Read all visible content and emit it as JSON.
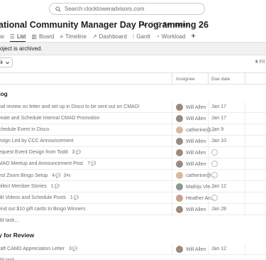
{
  "search": {
    "placeholder": "Search clocktoweradvisors.com"
  },
  "project": {
    "title": "ational Community Manager Day Programming 26",
    "set_status": "Set status"
  },
  "tabs": [
    {
      "label": "w",
      "icon": "overview-icon"
    },
    {
      "label": "List",
      "icon": "list-icon"
    },
    {
      "label": "Board",
      "icon": "board-icon"
    },
    {
      "label": "Timeline",
      "icon": "timeline-icon"
    },
    {
      "label": "Dashboard",
      "icon": "dashboard-icon"
    },
    {
      "label": "Gantt",
      "icon": "gantt-icon"
    },
    {
      "label": "Workload",
      "icon": "workload-icon"
    }
  ],
  "banner": {
    "text": "oject is archived."
  },
  "toolbar": {
    "add_label": "k",
    "filter_label": "Fil"
  },
  "columns": {
    "assignee": "Assignee",
    "due_date": "Due date"
  },
  "sections": [
    {
      "title": "log",
      "tasks": [
        {
          "name": "nal review on letter and set up in Disco to be sent out on CMAD!",
          "count": "",
          "assignee": "Will Allen",
          "due": "Jan 17",
          "avatar_color": "#9a8a80"
        },
        {
          "name": "reate and Schedule Internal CMAD Promotion",
          "count": "",
          "assignee": "Will Allen",
          "due": "Jan 17",
          "avatar_color": "#9a8a80"
        },
        {
          "name": "chedule Event in Disco",
          "count": "",
          "assignee": "catherine@...",
          "due": "Jan 9",
          "avatar_color": "#d8b8a0"
        },
        {
          "name": "esign Led by CCC Announcement",
          "count": "",
          "assignee": "Will Allen",
          "due": "Jan 10",
          "avatar_color": "#9a8a80"
        },
        {
          "name": "equest Event Design from Todd",
          "count": "3",
          "assignee": "Will Allen",
          "due": "",
          "avatar_color": "#9a8a80"
        },
        {
          "name": "MAD Meetup and Announcement Post",
          "count": "7",
          "assignee": "Will Allen",
          "due": "",
          "avatar_color": "#9a8a80"
        },
        {
          "name": "est Zoom Bingo Setup",
          "count": "4",
          "count2": "3",
          "assignee": "catherine@...",
          "due": "",
          "avatar_color": "#d8b8a0"
        },
        {
          "name": "ollect Member Stories",
          "count": "1",
          "assignee": "Mathijs Vle...",
          "due": "Jan 12",
          "avatar_color": "#8a9a8a"
        },
        {
          "name": "dit Videos and Schedule Posts",
          "count": "1",
          "assignee": "Heather An...",
          "due": "",
          "avatar_color": "#c8a090"
        },
        {
          "name": "end out $10 gift cards to Bingo Winners",
          "count": "",
          "assignee": "Will Allen",
          "due": "Jan 28",
          "avatar_color": "#9a8a80"
        }
      ],
      "add_task": "dd task..."
    },
    {
      "title": "y for Review",
      "tasks": [
        {
          "name": "raft CAMD Appreciation Letter",
          "count": "3",
          "assignee": "Will Allen",
          "due": "Jan 12",
          "avatar_color": "#9a8a80"
        }
      ],
      "add_task": "dd task..."
    }
  ]
}
